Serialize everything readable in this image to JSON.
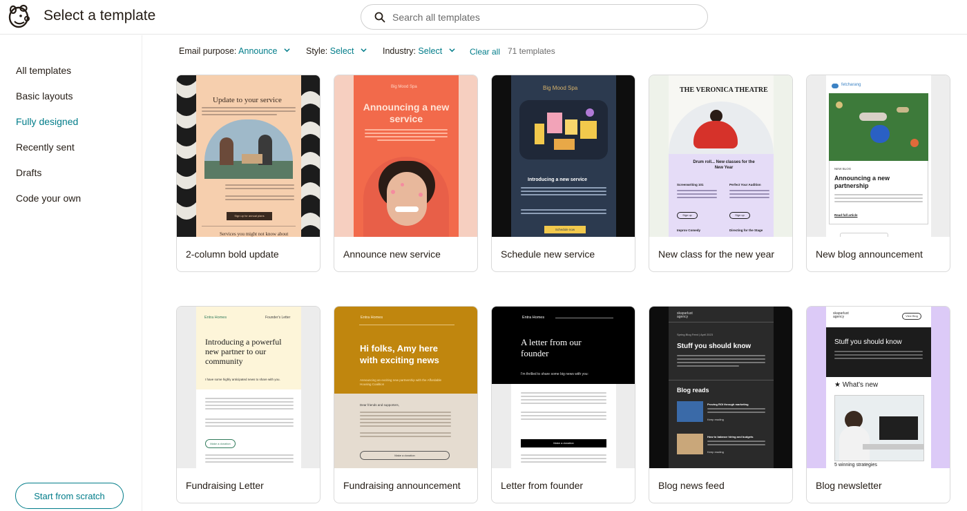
{
  "header": {
    "title": "Select a template",
    "search_placeholder": "Search all templates"
  },
  "sidebar": {
    "items": [
      {
        "label": "All templates",
        "active": false
      },
      {
        "label": "Basic layouts",
        "active": false
      },
      {
        "label": "Fully designed",
        "active": true
      },
      {
        "label": "Recently sent",
        "active": false
      },
      {
        "label": "Drafts",
        "active": false
      },
      {
        "label": "Code your own",
        "active": false
      }
    ],
    "start_button": "Start from scratch"
  },
  "filters": {
    "purpose_label": "Email purpose:",
    "purpose_value": "Announce",
    "style_label": "Style:",
    "style_value": "Select",
    "industry_label": "Industry:",
    "industry_value": "Select",
    "clear_all": "Clear all",
    "count": "71 templates"
  },
  "colors": {
    "accent": "#007c89",
    "text": "#241c15",
    "border": "#d9d9d9"
  },
  "templates": [
    {
      "label": "2-column bold update",
      "preview": {
        "headline": "Update to your service",
        "button": "Sign up for annual plans",
        "footer": "Services you might not know about"
      }
    },
    {
      "label": "Announce new service",
      "preview": {
        "brand": "Big Mood Spa",
        "headline": "Announcing a new service"
      }
    },
    {
      "label": "Schedule new service",
      "preview": {
        "brand": "Big Mood Spa",
        "headline": "Introducing a new service",
        "button": "Schedule now"
      }
    },
    {
      "label": "New class for the new year",
      "preview": {
        "brand": "THE VERONICA THEATRE",
        "headline": "Drum roll... New classes for the New Year",
        "col1": "Screenwriting 101",
        "col2": "Perfect Your Audition",
        "button": "Sign up",
        "col3": "Improv Comedy",
        "col4": "Directing for the Stage"
      }
    },
    {
      "label": "New blog announcement",
      "preview": {
        "brand": "fetcharang",
        "tag": "NEW BLOG",
        "headline": "Announcing a new partnership",
        "link": "Read full article"
      }
    },
    {
      "label": "Fundraising Letter",
      "preview": {
        "brand": "Entra Homes",
        "tag": "Founder's Letter",
        "headline": "Introducing a powerful new partner to our community",
        "sub": "I have some highly anticipated news to share with you.",
        "button": "Make a donation"
      }
    },
    {
      "label": "Fundraising announcement",
      "preview": {
        "brand": "Entra Homes",
        "headline": "Hi folks, Amy here with exciting news",
        "sub": "Announcing an exciting new partnership with the Affordable Housing Coalition",
        "greeting": "Dear friends and supporters,",
        "button": "Make a donation"
      }
    },
    {
      "label": "Letter from founder",
      "preview": {
        "brand": "Entra Homes",
        "headline": "A letter from our founder",
        "sub": "I'm thrilled to share some big news with you:",
        "button": "Make a donation"
      }
    },
    {
      "label": "Blog news feed",
      "preview": {
        "brand": "skaparlust agency",
        "tag": "Spring Blog Feed | April 2023",
        "headline": "Stuff you should know",
        "section": "Blog reads",
        "item1": "Proving ROI through marketing",
        "item2": "How to balance hiring and budgets",
        "more": "Keep reading"
      }
    },
    {
      "label": "Blog newsletter",
      "preview": {
        "brand": "skaparlust agency",
        "button": "View Blog",
        "headline": "Stuff you should know",
        "section": "★ What's new",
        "footer": "5 winning strategies"
      }
    }
  ]
}
